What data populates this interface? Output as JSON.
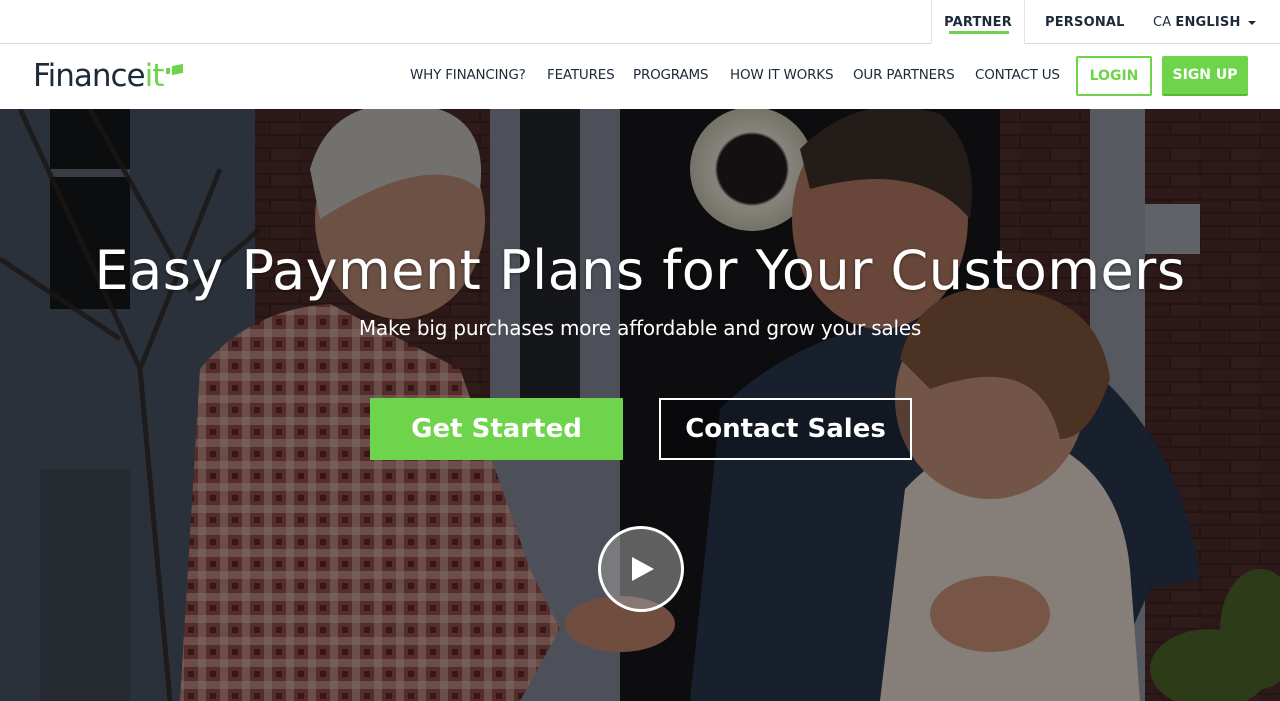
{
  "utility_bar": {
    "partner": "PARTNER",
    "personal": "PERSONAL",
    "region": "CA",
    "language": "ENGLISH"
  },
  "brand": {
    "logo_main": "Finance",
    "logo_accent": "it",
    "accent_color": "#6dd44b",
    "text_color": "#1d2a3a"
  },
  "nav": {
    "items": [
      {
        "label": "WHY FINANCING?"
      },
      {
        "label": "FEATURES"
      },
      {
        "label": "PROGRAMS"
      },
      {
        "label": "HOW IT WORKS"
      },
      {
        "label": "OUR PARTNERS"
      },
      {
        "label": "CONTACT US"
      }
    ],
    "login": "LOGIN",
    "signup": "SIGN UP"
  },
  "hero": {
    "title": "Easy Payment Plans for Your Customers",
    "subtitle": "Make big purchases more affordable and grow your sales",
    "primary_cta": "Get Started",
    "secondary_cta": "Contact Sales",
    "video_button": "play-icon"
  }
}
